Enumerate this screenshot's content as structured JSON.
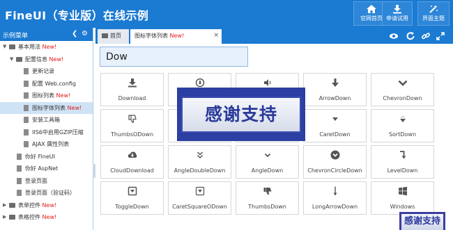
{
  "header": {
    "title": "FineUI（专业版）在线示例",
    "buttons": [
      {
        "label": "官网首页",
        "icon": "home-icon"
      },
      {
        "label": "申请试用",
        "icon": "download-icon"
      },
      {
        "label": "界面主题",
        "icon": "magic-wand-icon"
      }
    ]
  },
  "sidebar": {
    "title": "示例菜单",
    "items": [
      {
        "label": "基本用法",
        "badge": "New!",
        "type": "folder",
        "expanded": true
      },
      {
        "label": "配置信息",
        "badge": "New!",
        "type": "folder",
        "expanded": true
      },
      {
        "label": "更新记录",
        "badge": "",
        "type": "file"
      },
      {
        "label": "配置 Web.config",
        "badge": "",
        "type": "file"
      },
      {
        "label": "图标列表",
        "badge": "New!",
        "type": "file"
      },
      {
        "label": "图标字体列表",
        "badge": "New!",
        "type": "file",
        "selected": true
      },
      {
        "label": "安装工具箱",
        "badge": "",
        "type": "file"
      },
      {
        "label": "IIS6中启用GZIP压缩",
        "badge": "",
        "type": "file"
      },
      {
        "label": "AJAX 属性列表",
        "badge": "",
        "type": "file"
      },
      {
        "label": "你好 FineUI",
        "badge": "",
        "type": "file"
      },
      {
        "label": "你好 AspNet",
        "badge": "",
        "type": "file"
      },
      {
        "label": "登录页面",
        "badge": "",
        "type": "file"
      },
      {
        "label": "登录页面（验证码）",
        "badge": "",
        "type": "file"
      },
      {
        "label": "表单控件",
        "badge": "New!",
        "type": "folder",
        "expanded": false
      },
      {
        "label": "表格控件",
        "badge": "New!",
        "type": "folder",
        "expanded": false
      }
    ]
  },
  "tabs": {
    "home": "首页",
    "active": "图标字体列表",
    "active_badge": "New!"
  },
  "search": {
    "value": "Dow"
  },
  "icons": [
    {
      "label": "Download",
      "icon": "download-icon"
    },
    {
      "label": "",
      "icon": "circle-download-icon"
    },
    {
      "label": "",
      "icon": "volume-down-icon"
    },
    {
      "label": "ArrowDown",
      "icon": "arrow-down-icon"
    },
    {
      "label": "ChevronDown",
      "icon": "chevron-down-icon"
    },
    {
      "label": "ThumbsODown",
      "icon": "thumbs-o-down-icon"
    },
    {
      "label": "",
      "icon": "hidden-icon"
    },
    {
      "label": "",
      "icon": "hidden-icon"
    },
    {
      "label": "CaretDown",
      "icon": "caret-down-icon"
    },
    {
      "label": "SortDown",
      "icon": "sort-down-icon"
    },
    {
      "label": "CloudDownload",
      "icon": "cloud-download-icon"
    },
    {
      "label": "AngleDoubleDown",
      "icon": "angle-double-down-icon"
    },
    {
      "label": "AngleDown",
      "icon": "angle-down-icon"
    },
    {
      "label": "ChevronCircleDown",
      "icon": "chevron-circle-down-icon"
    },
    {
      "label": "LevelDown",
      "icon": "level-down-icon"
    },
    {
      "label": "ToggleDown",
      "icon": "toggle-down-icon"
    },
    {
      "label": "CaretSquareODown",
      "icon": "caret-square-o-down-icon"
    },
    {
      "label": "ThumbsDown",
      "icon": "thumbs-down-icon"
    },
    {
      "label": "LongArrowDown",
      "icon": "long-arrow-down-icon"
    },
    {
      "label": "Windows",
      "icon": "windows-icon"
    }
  ],
  "overlay": {
    "text": "感谢支持",
    "small_text": "感谢支持"
  }
}
